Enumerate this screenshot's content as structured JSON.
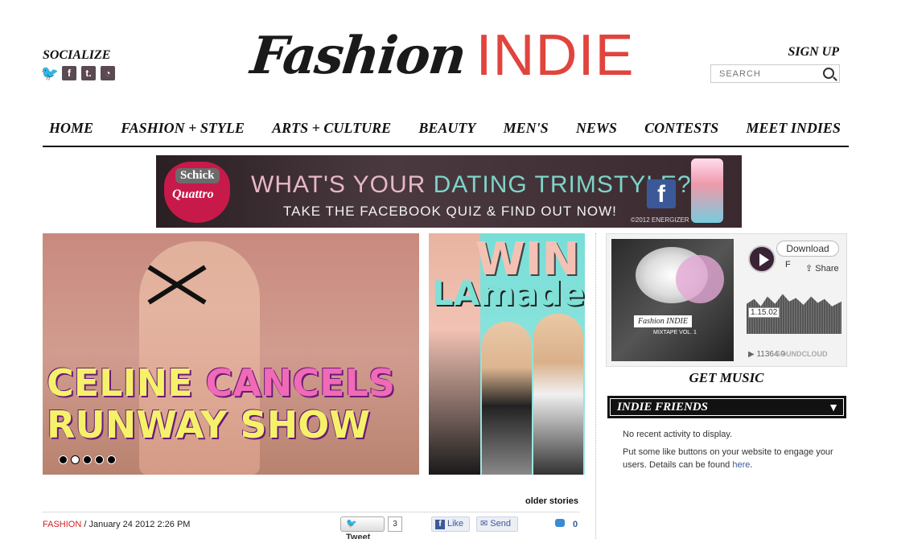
{
  "header": {
    "socialize_label": "SOCIALIZE",
    "social_icons": [
      "twitter-icon",
      "facebook-icon",
      "tumblr-icon",
      "rss-icon"
    ],
    "logo_script": "Fashion",
    "logo_indie": "INDIE",
    "signup_label": "SIGN UP",
    "search_placeholder": "SEARCH"
  },
  "nav": {
    "items": [
      "HOME",
      "FASHION + STYLE",
      "ARTS + CULTURE",
      "BEAUTY",
      "MEN'S",
      "NEWS",
      "CONTESTS",
      "MEET INDIES"
    ]
  },
  "banner": {
    "brand": "Schick",
    "product": "Quattro",
    "headline_prefix": "WHAT'S YOUR ",
    "headline_accent": "DATING TRIMSTYLE?",
    "subline": "TAKE THE FACEBOOK QUIZ & FIND OUT NOW!",
    "copyright": "©2012 ENERGIZER"
  },
  "feature": {
    "title_line1_a": "CELINE ",
    "title_line1_b": "CANCELS",
    "title_line2": "RUNWAY SHOW",
    "slide_count": 5,
    "active_slide": 2
  },
  "promo": {
    "win": "WIN!",
    "brand": "LAmade"
  },
  "music": {
    "download_label": "Download",
    "track_letter": "F",
    "share_label": "Share",
    "time": "1.15.02",
    "stats": "▶ 11364   9",
    "source": "SOUNDCLOUD",
    "album_title": "Fashion INDIE",
    "album_sub": "MIXTAPE VOL. 1"
  },
  "get_music_label": "GET MUSIC",
  "indie_friends": {
    "title": "INDIE FRIENDS",
    "no_activity": "No recent activity to display.",
    "help_text": "Put some like buttons on your website to engage your users. Details can be found ",
    "help_link": "here"
  },
  "post": {
    "older_stories": "older stories",
    "category": "FASHION",
    "date": " / January 24 2012 2:26 PM",
    "tweet_label": "Tweet",
    "tweet_count": "3",
    "like_label": "Like",
    "send_label": "Send",
    "comment_count": "0"
  },
  "colors": {
    "brand_red": "#e0443d",
    "link_blue": "#3b5998",
    "category_red": "#d4202a"
  }
}
